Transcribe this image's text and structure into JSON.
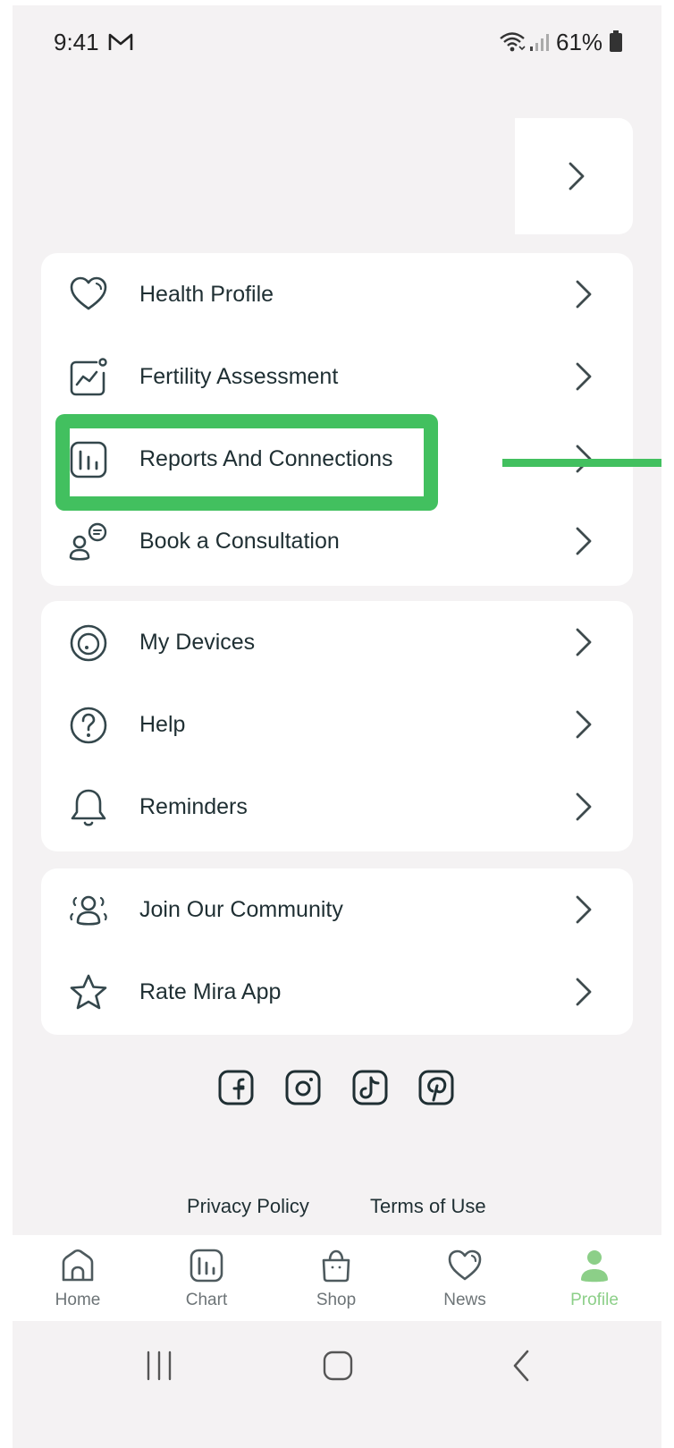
{
  "status_bar": {
    "time": "9:41",
    "battery": "61%"
  },
  "menu": {
    "group1": [
      {
        "label": "Health Profile",
        "icon": "heart-icon"
      },
      {
        "label": "Fertility Assessment",
        "icon": "assessment-chart-icon"
      },
      {
        "label": "Reports And Connections",
        "icon": "reports-chart-icon"
      },
      {
        "label": "Book a Consultation",
        "icon": "consultation-icon"
      }
    ],
    "group2": [
      {
        "label": "My Devices",
        "icon": "device-icon"
      },
      {
        "label": "Help",
        "icon": "help-icon"
      },
      {
        "label": "Reminders",
        "icon": "bell-icon"
      }
    ],
    "group3": [
      {
        "label": "Join Our Community",
        "icon": "community-icon"
      },
      {
        "label": "Rate Mira App",
        "icon": "star-icon"
      }
    ]
  },
  "social": [
    "facebook-icon",
    "instagram-icon",
    "tiktok-icon",
    "pinterest-icon"
  ],
  "footer": {
    "privacy": "Privacy Policy",
    "terms": "Terms of Use"
  },
  "tabs": [
    {
      "label": "Home",
      "icon": "home-icon"
    },
    {
      "label": "Chart",
      "icon": "chart-icon"
    },
    {
      "label": "Shop",
      "icon": "shop-bag-icon"
    },
    {
      "label": "News",
      "icon": "heart-icon"
    },
    {
      "label": "Profile",
      "icon": "profile-icon",
      "active": true
    }
  ],
  "colors": {
    "background": "#f4f2f3",
    "card": "#ffffff",
    "text": "#1f2f33",
    "highlight": "#42c05f",
    "active_tab": "#8ccf88",
    "inactive_tab": "#6d7477"
  }
}
